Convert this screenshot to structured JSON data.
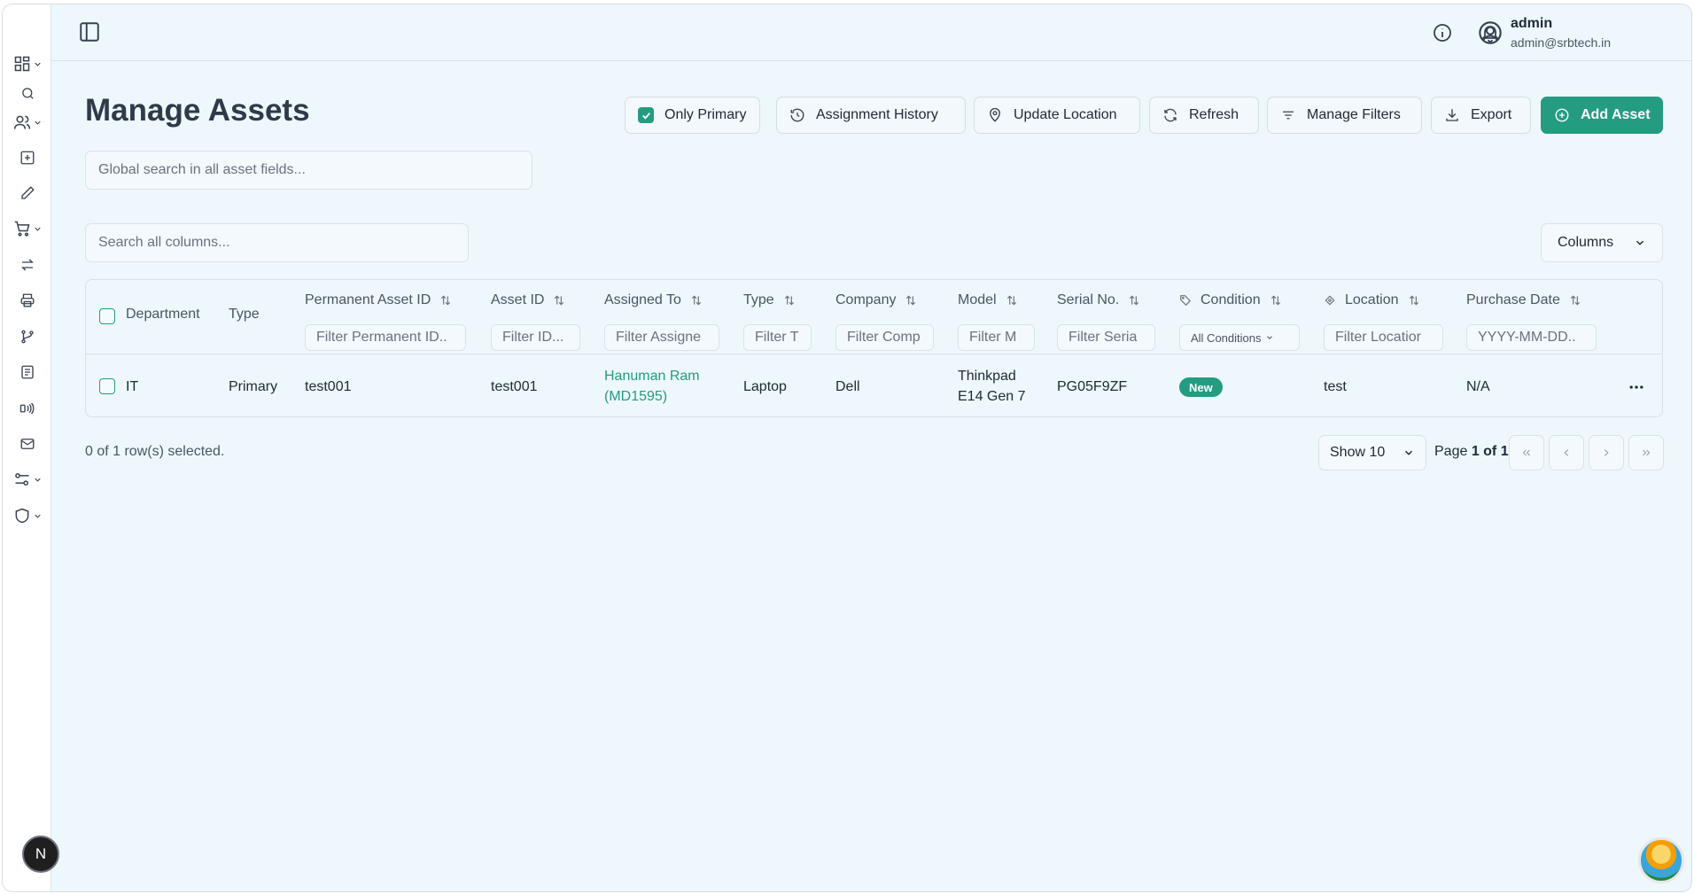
{
  "colors": {
    "accent": "#239c82",
    "background": "#eef7fb",
    "text": "#1f2937"
  },
  "sidebar": {
    "items": [
      {
        "icon": "dashboard-grid-icon",
        "has_chevron": true
      },
      {
        "icon": "search-icon",
        "has_chevron": false
      },
      {
        "icon": "users-icon",
        "has_chevron": true
      },
      {
        "icon": "plus-square-icon",
        "has_chevron": false
      },
      {
        "icon": "pencil-icon",
        "has_chevron": false
      },
      {
        "icon": "cart-icon",
        "has_chevron": true
      },
      {
        "icon": "transfer-arrows-icon",
        "has_chevron": false
      },
      {
        "icon": "printer-icon",
        "has_chevron": false
      },
      {
        "icon": "git-branch-icon",
        "has_chevron": false
      },
      {
        "icon": "report-list-icon",
        "has_chevron": false
      },
      {
        "icon": "rfid-signal-icon",
        "has_chevron": false
      },
      {
        "icon": "mail-icon",
        "has_chevron": false
      },
      {
        "icon": "settings-sliders-icon",
        "has_chevron": true
      },
      {
        "icon": "shield-icon",
        "has_chevron": true
      }
    ],
    "badge_letter": "N"
  },
  "header": {
    "user_name": "admin",
    "user_email": "admin@srbtech.in"
  },
  "page": {
    "title": "Manage Assets",
    "global_search_placeholder": "Global search in all asset fields...",
    "column_search_placeholder": "Search all columns...",
    "columns_label": "Columns"
  },
  "toolbar": {
    "only_primary": "Only Primary",
    "only_primary_checked": true,
    "assignment_history": "Assignment History",
    "update_location": "Update Location",
    "refresh": "Refresh",
    "manage_filters": "Manage Filters",
    "export": "Export",
    "add_asset": "Add Asset"
  },
  "table": {
    "columns": [
      {
        "key": "department",
        "label": "Department"
      },
      {
        "key": "type",
        "label": "Type"
      },
      {
        "key": "permanent_asset_id",
        "label": "Permanent Asset ID",
        "filter": "Filter Permanent ID.."
      },
      {
        "key": "asset_id",
        "label": "Asset ID",
        "filter": "Filter ID..."
      },
      {
        "key": "assigned_to",
        "label": "Assigned To",
        "filter": "Filter Assigne"
      },
      {
        "key": "asset_type",
        "label": "Type",
        "filter": "Filter T"
      },
      {
        "key": "company",
        "label": "Company",
        "filter": "Filter Comp"
      },
      {
        "key": "model",
        "label": "Model",
        "filter": "Filter M"
      },
      {
        "key": "serial_no",
        "label": "Serial No.",
        "filter": "Filter Seria"
      },
      {
        "key": "condition",
        "label": "Condition",
        "filter": "All Conditions"
      },
      {
        "key": "location",
        "label": "Location",
        "filter": "Filter Locatior"
      },
      {
        "key": "purchase_date",
        "label": "Purchase Date",
        "filter": "YYYY-MM-DD.."
      }
    ],
    "rows": [
      {
        "department": "IT",
        "type": "Primary",
        "permanent_asset_id": "test001",
        "asset_id": "test001",
        "assigned_to_line1": "Hanuman Ram",
        "assigned_to_line2": "(MD1595)",
        "asset_type": "Laptop",
        "company": "Dell",
        "model_line1": "Thinkpad",
        "model_line2": "E14 Gen 7",
        "serial_no": "PG05F9ZF",
        "condition": "New",
        "location": "test",
        "purchase_date": "N/A"
      }
    ]
  },
  "footer": {
    "selection": "0 of 1 row(s) selected.",
    "show": "Show 10",
    "page_prefix": "Page ",
    "page_value": "1 of 1"
  }
}
